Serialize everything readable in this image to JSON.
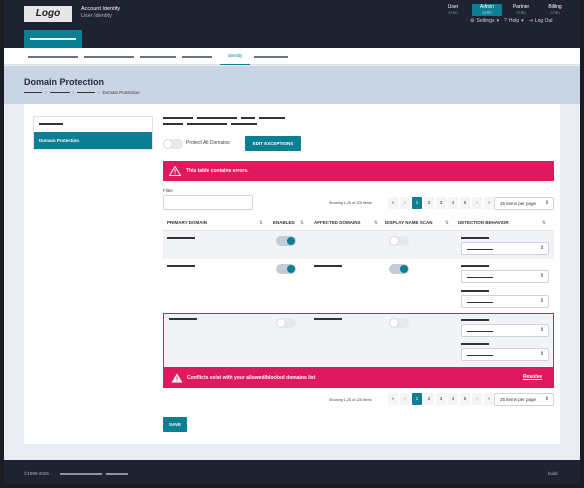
{
  "header": {
    "logo": "Logo",
    "account_title": "Account Identity",
    "account_sub": "User Identity",
    "roles": [
      {
        "label": "User",
        "sub": "STRD",
        "active": false
      },
      {
        "label": "Admin",
        "sub": "STRD",
        "active": true
      },
      {
        "label": "Partner",
        "sub": "STRD",
        "active": false
      },
      {
        "label": "Billing",
        "sub": "STRD",
        "active": false
      }
    ],
    "settings_label": "Settings",
    "help_label": "Help",
    "logout_label": "Log Out"
  },
  "tabs": {
    "active_label": "Identity"
  },
  "page": {
    "title": "Domain Protection",
    "breadcrumb_current": "Domain Protection"
  },
  "sidebar": {
    "active_label": "Domain Protection"
  },
  "controls": {
    "protect_all_label": "Protect All Domains",
    "protect_all_on": false,
    "edit_exceptions_label": "EDIT EXCEPTIONS"
  },
  "alerts": {
    "table_error": "This table contains errors.",
    "conflict": "Conflicts exist with your allowed/blocked domains list",
    "resolve_label": "Resolve",
    "color": "#e0195f"
  },
  "filter": {
    "label": "Filter",
    "value": ""
  },
  "pagination": {
    "showing": "Showing 1-25 of 125 items",
    "first": "«",
    "prev": "‹",
    "pages": [
      "1",
      "2",
      "3",
      "4",
      "5"
    ],
    "current": "1",
    "next": "›",
    "last": "»",
    "per_page": "25 items per page"
  },
  "table": {
    "columns": [
      "PRIMARY DOMAIN",
      "ENABLED",
      "AFFECTED DOMAINS",
      "DISPLAY NAME SCAN",
      "DETECTION BEHAVIOR"
    ],
    "rows": [
      {
        "enabled": true,
        "display_name_scan": false,
        "selects": 1
      },
      {
        "enabled": true,
        "display_name_scan": true,
        "selects": 2
      },
      {
        "enabled": false,
        "display_name_scan": false,
        "selects": 2,
        "error": true
      }
    ]
  },
  "save_label": "SAVE",
  "footer": {
    "copyright": "©1999-2026",
    "build": "build"
  },
  "colors": {
    "accent": "#0c7f93",
    "header": "#1f2230",
    "error": "#e0195f"
  }
}
